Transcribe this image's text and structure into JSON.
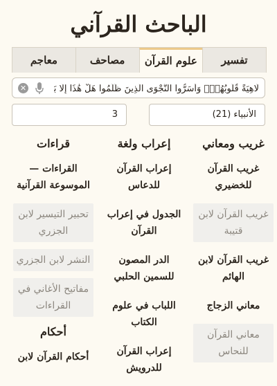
{
  "app": {
    "title": "الباحث القرآني"
  },
  "tabs": [
    {
      "label": "تفسير",
      "active": false
    },
    {
      "label": "علوم القرآن",
      "active": true
    },
    {
      "label": "مصاحف",
      "active": false
    },
    {
      "label": "معاجم",
      "active": false
    }
  ],
  "search": {
    "value": "لَاهِيَةً قُلُوبُهُمْۗ وَأَسَرُّوا النَّجْوَى الَّذِينَ ظَلَمُوا هَلْ هَٰذَا إِلَّا بَشَرٌ",
    "clear_icon": "clear-icon",
    "mic_icon": "microphone-icon"
  },
  "selectors": {
    "surah": "الأنبياء (21)",
    "ayah": "3"
  },
  "columns": [
    {
      "heading": "غريب ومعاني",
      "items": [
        {
          "label": "غريب القرآن للخضيري",
          "enabled": true
        },
        {
          "label": "غريب القرآن لابن قتيبة",
          "enabled": false
        },
        {
          "label": "غريب القرآن لابن الهائم",
          "enabled": true
        },
        {
          "label": "معاني الزجاج",
          "enabled": true
        },
        {
          "label": "معاني القرآن للنحاس",
          "enabled": false
        }
      ]
    },
    {
      "heading": "إعراب ولغة",
      "items": [
        {
          "label": "إعراب القرآن للدعاس",
          "enabled": true
        },
        {
          "label": "الجدول في إعراب القرآن",
          "enabled": true
        },
        {
          "label": "الدر المصون للسمين الحلبي",
          "enabled": true
        },
        {
          "label": "اللباب في علوم الكتاب",
          "enabled": true
        },
        {
          "label": "إعراب القرآن للدرويش",
          "enabled": true
        }
      ]
    },
    {
      "heading": "قراءات",
      "items": [
        {
          "label": "القراءات — الموسوعة القرآنية",
          "enabled": true
        },
        {
          "label": "تحبير التيسير لابن الجزري",
          "enabled": false
        },
        {
          "label": "النشر لابن الجزري",
          "enabled": false
        },
        {
          "label": "مفاتيح الأغاني في القراءات",
          "enabled": false
        }
      ],
      "heading2": "أحكام",
      "items2": [
        {
          "label": "أحكام القرآن لابن",
          "enabled": true
        }
      ]
    }
  ]
}
